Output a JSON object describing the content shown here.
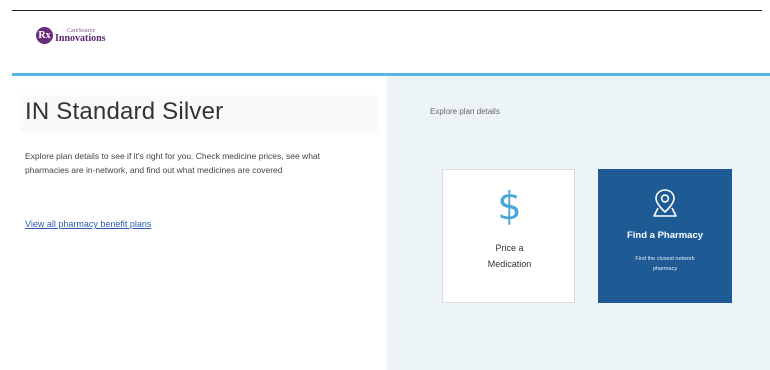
{
  "header": {
    "logo_mark": "Rx",
    "logo_small": "CareSource",
    "logo_big": "Innovations"
  },
  "plan": {
    "title": "IN Standard Silver",
    "description": "Explore plan details to see if it's right for you. Check medicine prices, see what pharmacies are in-network, and find out what medicines are covered",
    "link": "View all pharmacy benefit plans"
  },
  "explore": {
    "heading": "Explore plan details",
    "cards": [
      {
        "icon": "dollar-icon",
        "symbol": "$",
        "label": "Price a Medication"
      },
      {
        "icon": "map-pin-icon",
        "title": "Find a Pharmacy",
        "subtitle": "Find the closest network pharmacy"
      }
    ]
  },
  "colors": {
    "accent": "#55b6e0",
    "brand_purple": "#5b2a6e",
    "card_blue": "#1e5b94",
    "panel_bg": "#edf4f8",
    "link": "#2a5db0"
  }
}
